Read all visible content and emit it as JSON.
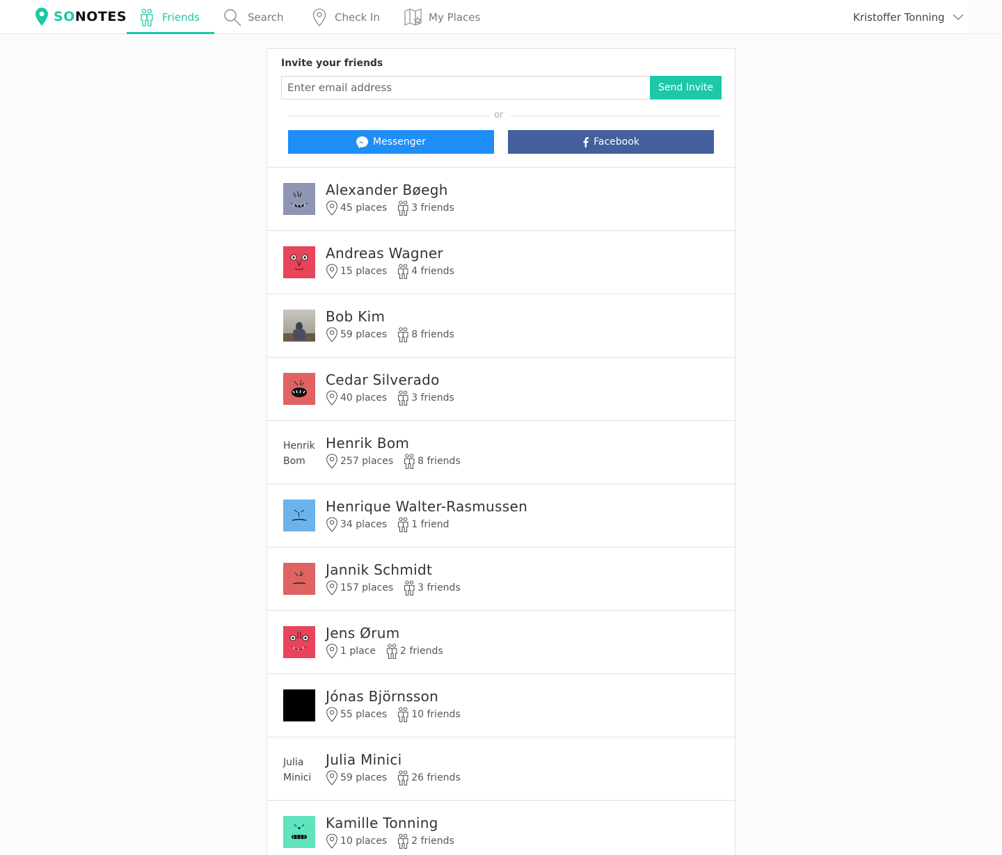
{
  "app": {
    "brand_prefix": "SO",
    "brand_suffix": "NOTES"
  },
  "nav": {
    "items": [
      {
        "label": "Friends",
        "icon": "friends-icon",
        "active": true
      },
      {
        "label": "Search",
        "icon": "search-icon",
        "active": false
      },
      {
        "label": "Check In",
        "icon": "location-pin-icon",
        "active": false
      },
      {
        "label": "My Places",
        "icon": "map-star-icon",
        "active": false
      }
    ],
    "user_name": "Kristoffer Tonning"
  },
  "invite": {
    "title": "Invite your friends",
    "email_placeholder": "Enter email address",
    "send_label": "Send Invite",
    "or_label": "or",
    "messenger_label": "Messenger",
    "facebook_label": "Facebook"
  },
  "colors": {
    "accent": "#1ec8a6",
    "messenger": "#1f8ef7",
    "facebook": "#43609c"
  },
  "friends": [
    {
      "name": "Alexander Bøegh",
      "places": "45 places",
      "friends": "3 friends",
      "avatar": "monster-grey"
    },
    {
      "name": "Andreas Wagner",
      "places": "15 places",
      "friends": "4 friends",
      "avatar": "monster-red"
    },
    {
      "name": "Bob Kim",
      "places": "59 places",
      "friends": "8 friends",
      "avatar": "photo"
    },
    {
      "name": "Cedar Silverado",
      "places": "40 places",
      "friends": "3 friends",
      "avatar": "monster-salmon"
    },
    {
      "name": "Henrik Bom",
      "places": "257 places",
      "friends": "8 friends",
      "avatar_alt_line1": "Henrik",
      "avatar_alt_line2": "Bom"
    },
    {
      "name": "Henrique Walter-Rasmussen",
      "places": "34 places",
      "friends": "1 friend",
      "avatar": "monster-blue"
    },
    {
      "name": "Jannik Schmidt",
      "places": "157 places",
      "friends": "3 friends",
      "avatar": "monster-salmon-2"
    },
    {
      "name": "Jens Ørum",
      "places": "1 place",
      "friends": "2 friends",
      "avatar": "monster-red-2"
    },
    {
      "name": "Jónas Björnsson",
      "places": "55 places",
      "friends": "10 friends",
      "avatar": "photo-bw"
    },
    {
      "name": "Julia Minici",
      "places": "59 places",
      "friends": "26 friends",
      "avatar_alt_line1": "Julia",
      "avatar_alt_line2": "Minici"
    },
    {
      "name": "Kamille Tonning",
      "places": "10 places",
      "friends": "2 friends",
      "avatar": "monster-green"
    }
  ]
}
